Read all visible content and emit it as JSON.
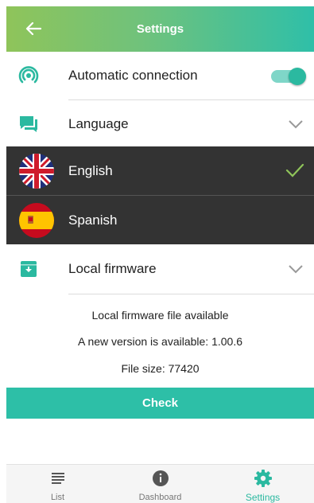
{
  "header": {
    "title": "Settings"
  },
  "settings": {
    "auto_connection": {
      "label": "Automatic connection",
      "enabled": true
    },
    "language": {
      "label": "Language",
      "options": [
        {
          "label": "English",
          "selected": true
        },
        {
          "label": "Spanish",
          "selected": false
        }
      ]
    },
    "local_firmware": {
      "label": "Local firmware"
    }
  },
  "firmware_info": {
    "line1": "Local firmware file available",
    "line2": "A new version is available: 1.00.6",
    "line3": "File size: 77420",
    "check_label": "Check"
  },
  "bottom_nav": {
    "items": [
      {
        "label": "List",
        "icon": "list-icon"
      },
      {
        "label": "Dashboard",
        "icon": "info-icon"
      },
      {
        "label": "Settings",
        "icon": "gear-icon",
        "active": true
      }
    ]
  },
  "colors": {
    "accent": "#2bb9a0",
    "dark_row": "#333333",
    "check": "#8fc45a"
  }
}
